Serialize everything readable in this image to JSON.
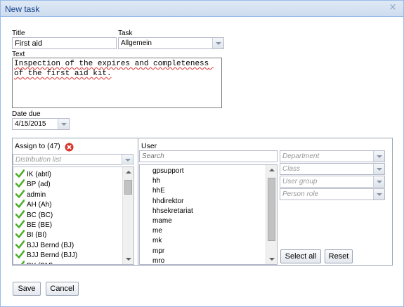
{
  "window": {
    "title": "New task",
    "close_icon": "×"
  },
  "form": {
    "title_label": "Title",
    "title_value": "First aid",
    "task_label": "Task",
    "task_value": "Allgemein",
    "text_label": "Text",
    "text_value": "Inspection of the expires and completeness of the first aid kit.",
    "date_label": "Date due",
    "date_value": "4/15/2015"
  },
  "assign": {
    "label": "Assign to (47)",
    "distribution_placeholder": "Distribution list",
    "items": [
      "IK (abtl)",
      "BP (ad)",
      "admin",
      "AH (Ah)",
      "BC (BC)",
      "BE (BE)",
      "BI (BI)",
      "BJJ Bernd (BJ)",
      "BJJ Bernd (BJJ)",
      "BY (BM)"
    ]
  },
  "user": {
    "label": "User",
    "search_placeholder": "Search",
    "items": [
      "gpsupport",
      "hh",
      "hhE",
      "hhdirektor",
      "hhsekretariat",
      "mame",
      "me",
      "mk",
      "mpr",
      "mro"
    ]
  },
  "filters": {
    "department": "Department",
    "class": "Class",
    "user_group": "User group",
    "person_role": "Person role",
    "select_all": "Select all",
    "reset": "Reset"
  },
  "footer": {
    "save": "Save",
    "cancel": "Cancel"
  },
  "colors": {
    "titlebar": "#cddcef",
    "title_text": "#15428b",
    "check": "#4caf2a",
    "error": "#d9342b"
  }
}
